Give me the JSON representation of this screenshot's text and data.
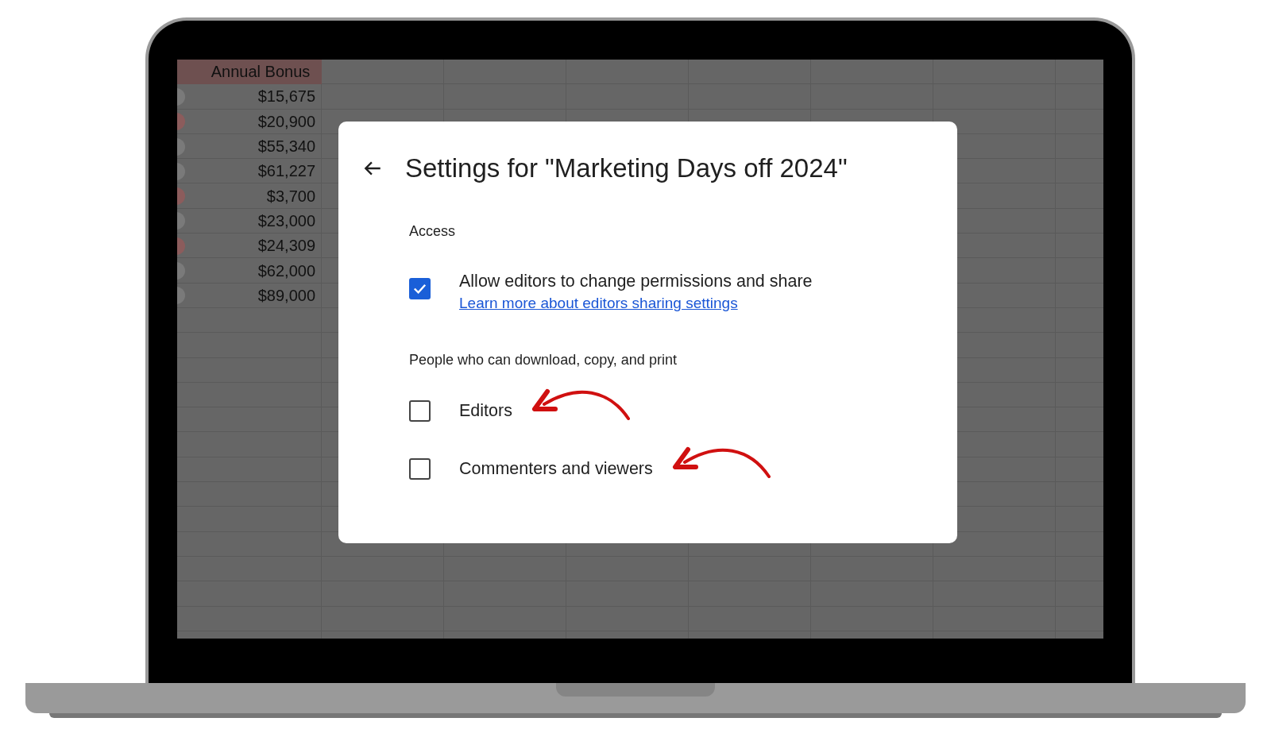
{
  "spreadsheet": {
    "header": "Annual Bonus",
    "rows": [
      {
        "value": "$15,675",
        "color": "#7a7a7a"
      },
      {
        "value": "$20,900",
        "color": "#8c5c5c"
      },
      {
        "value": "$55,340",
        "color": "#7a7a7a"
      },
      {
        "value": "$61,227",
        "color": "#7a7a7a"
      },
      {
        "value": "$3,700",
        "color": "#8c5c5c"
      },
      {
        "value": "$23,000",
        "color": "#7a7a7a"
      },
      {
        "value": "$24,309",
        "color": "#8c5c5c"
      },
      {
        "value": "$62,000",
        "color": "#7a7a7a"
      },
      {
        "value": "$89,000",
        "color": "#7a7a7a"
      }
    ]
  },
  "dialog": {
    "title": "Settings for \"Marketing Days off 2024\"",
    "sections": [
      {
        "heading": "Access",
        "options": [
          {
            "label": "Allow editors to change permissions and share",
            "link": "Learn more about editors sharing settings",
            "checked": true,
            "annotated": false
          }
        ]
      },
      {
        "heading": "People who can download, copy, and print",
        "options": [
          {
            "label": "Editors",
            "checked": false,
            "annotated": true
          },
          {
            "label": "Commenters and viewers",
            "checked": false,
            "annotated": true
          }
        ]
      }
    ]
  }
}
